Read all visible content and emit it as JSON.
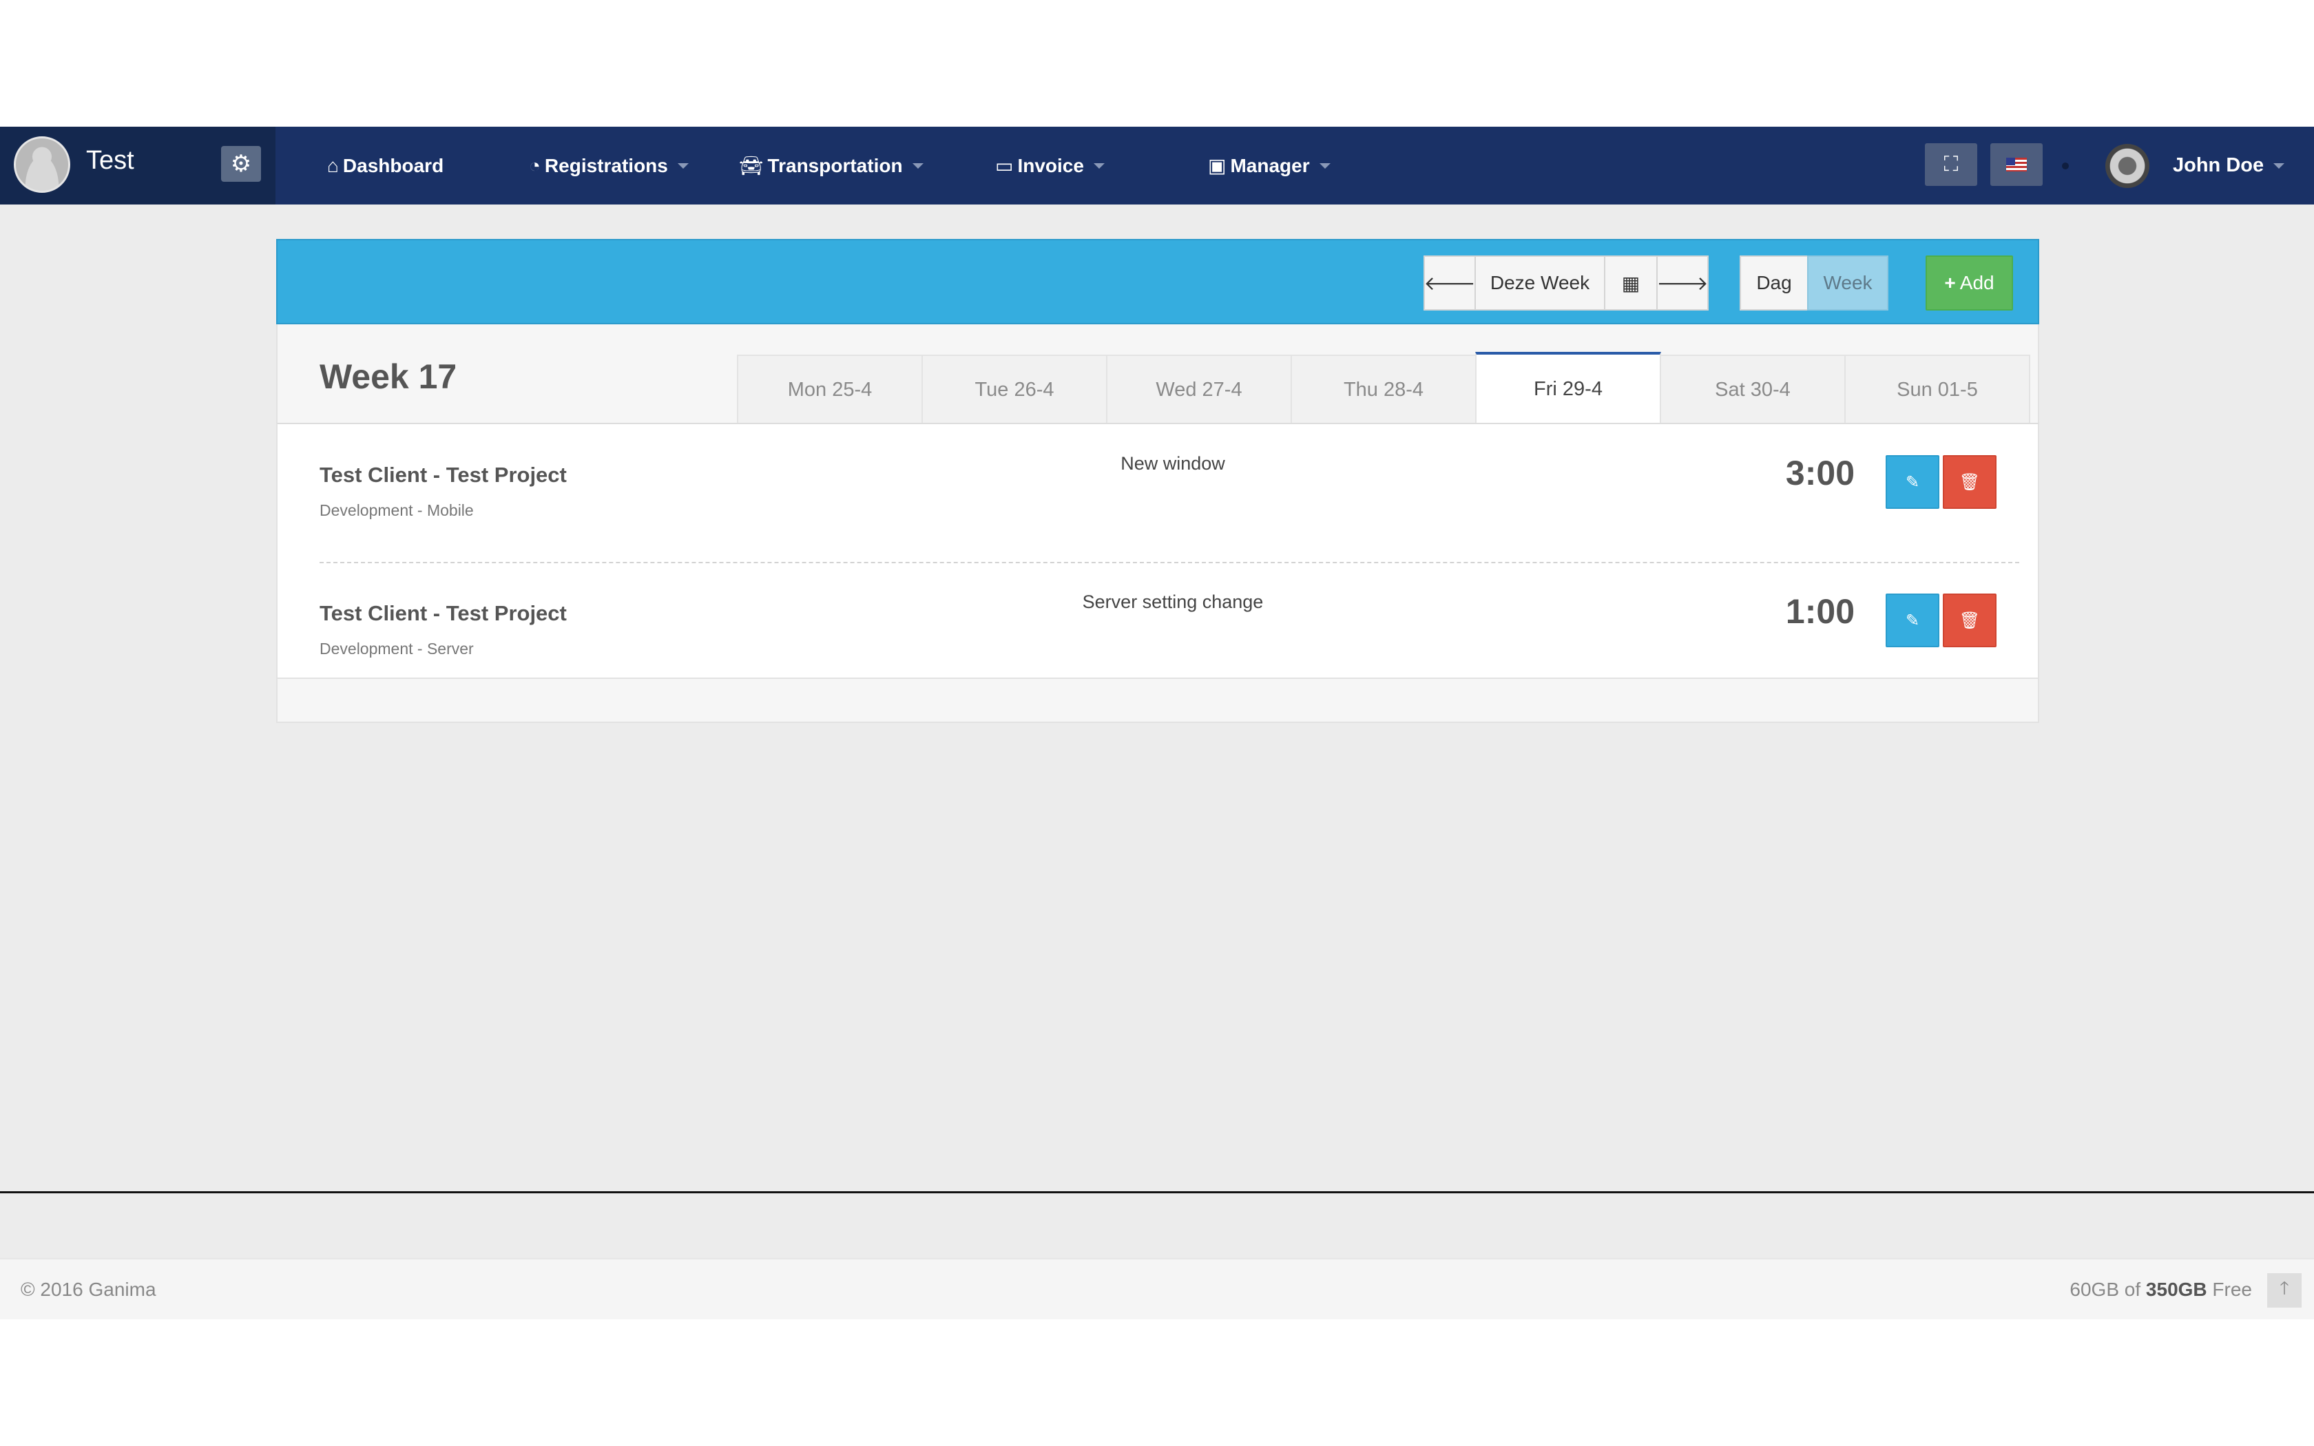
{
  "brand": {
    "name": "Test"
  },
  "nav": {
    "items": [
      {
        "label": "Dashboard",
        "icon": "home-icon",
        "has_caret": false
      },
      {
        "label": "Registrations",
        "icon": "dashboard-icon",
        "has_caret": true
      },
      {
        "label": "Transportation",
        "icon": "car-icon",
        "has_caret": true
      },
      {
        "label": "Invoice",
        "icon": "credit-card-icon",
        "has_caret": true
      },
      {
        "label": "Manager",
        "icon": "briefcase-icon",
        "has_caret": true
      }
    ],
    "user_name": "John Doe"
  },
  "toolbar": {
    "this_week_label": "Deze Week",
    "view_day_label": "Dag",
    "view_week_label": "Week",
    "active_view": "Week",
    "add_label": "Add"
  },
  "week": {
    "title": "Week 17",
    "days": [
      "Mon 25-4",
      "Tue 26-4",
      "Wed 27-4",
      "Thu 28-4",
      "Fri 29-4",
      "Sat 30-4",
      "Sun 01-5"
    ],
    "active_day": "Fri 29-4"
  },
  "entries": [
    {
      "title": "Test Client - Test Project",
      "subtitle": "Development - Mobile",
      "description": "New window",
      "time": "3:00"
    },
    {
      "title": "Test Client - Test Project",
      "subtitle": "Development - Server",
      "description": "Server setting change",
      "time": "1:00"
    }
  ],
  "footer": {
    "copyright": "© 2016 Ganima",
    "storage_used": "60GB of",
    "storage_total": "350GB",
    "storage_suffix": "Free"
  },
  "colors": {
    "navbar": "#1a3166",
    "toolbar": "#35addf",
    "add_button": "#5cb85c",
    "delete_button": "#e2523e",
    "edit_button": "#35addf"
  }
}
